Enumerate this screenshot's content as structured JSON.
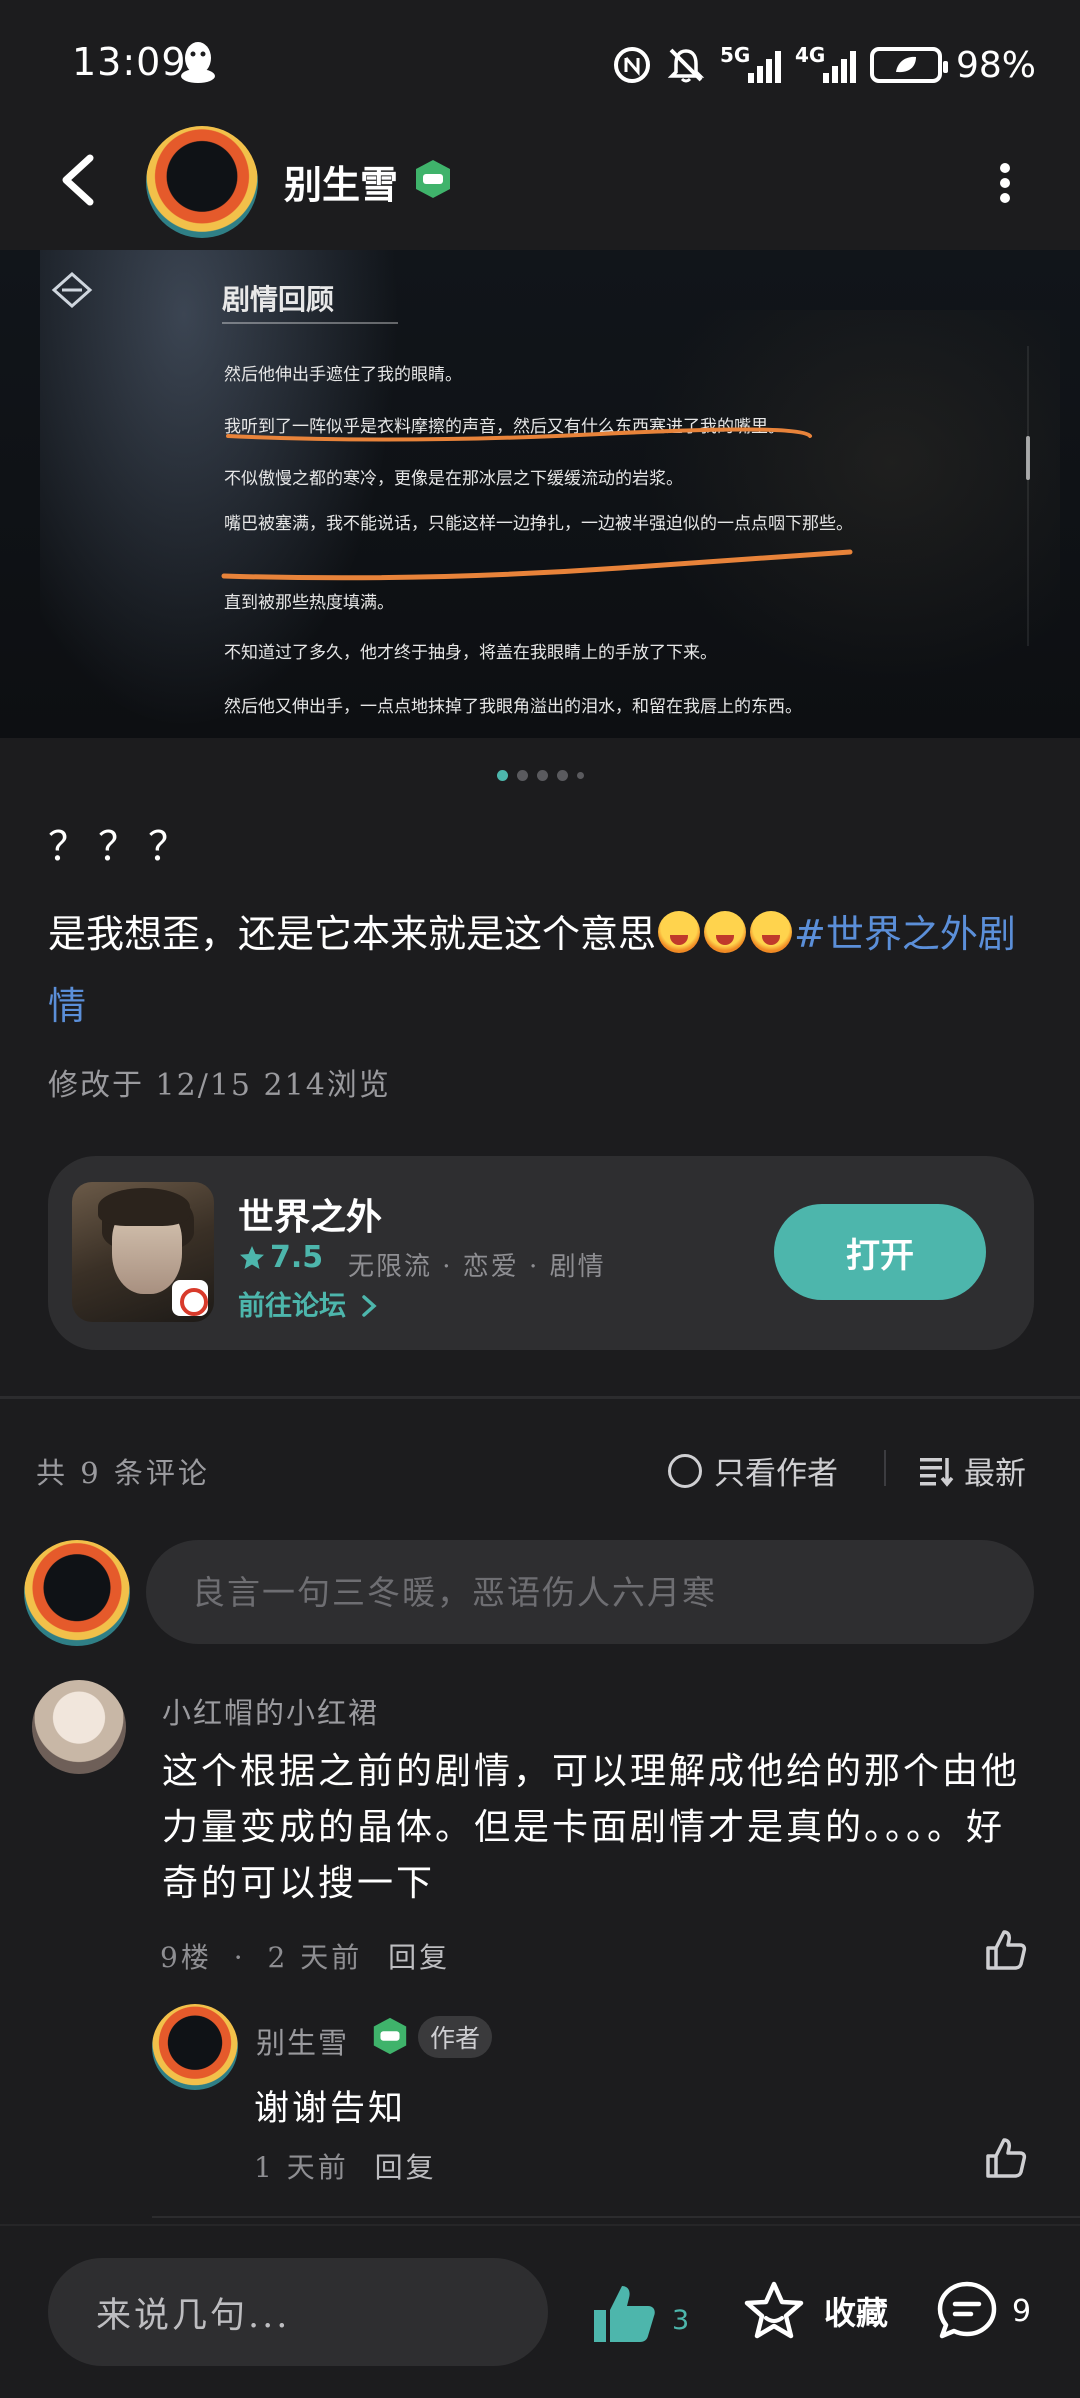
{
  "status_bar": {
    "time": "13:09",
    "battery": "98%",
    "net_5g": "5G",
    "net_4g": "4G"
  },
  "header": {
    "username": "别生雪"
  },
  "banner": {
    "title": "剧情回顾",
    "lines": [
      "然后他伸出手遮住了我的眼睛。",
      "我听到了一阵似乎是衣料摩擦的声音，然后又有什么东西塞进了我的嘴里。",
      "不似傲慢之都的寒冷，更像是在那冰层之下缓缓流动的岩浆。",
      "嘴巴被塞满，我不能说话，只能这样一边挣扎，一边被半强迫似的一点点咽下那些。",
      "直到被那些热度填满。",
      "不知道过了多久，他才终于抽身，将盖在我眼睛上的手放了下来。",
      "然后他又伸出手，一点点地抹掉了我眼角溢出的泪水，和留在我唇上的东西。"
    ],
    "page_count": 5,
    "active_page": 1
  },
  "post": {
    "title": "？？？",
    "body": "是我想歪，还是它本来就是这个意思",
    "tag": "#世界之外剧情",
    "meta": "修改于 12/15  214浏览"
  },
  "app_card": {
    "name": "世界之外",
    "rating": "7.5",
    "tags": "无限流 · 恋爱 · 剧情",
    "forum_link": "前往论坛",
    "open_label": "打开"
  },
  "comments_header": {
    "count_text": "共 9 条评论",
    "author_only": "只看作者",
    "sort": "最新"
  },
  "comment_input": {
    "placeholder": "良言一句三冬暖，恶语伤人六月寒"
  },
  "comment1": {
    "name": "小红帽的小红裙",
    "text": "这个根据之前的剧情，可以理解成他给的那个由他力量变成的晶体。但是卡面剧情才是真的。。。。好奇的可以搜一下",
    "floor": "9楼",
    "time": "2 天前",
    "reply": "回复"
  },
  "reply1": {
    "name": "别生雪",
    "badge": "作者",
    "text": "谢谢告知",
    "time": "1 天前",
    "reply": "回复"
  },
  "bottom_bar": {
    "input_placeholder": "来说几句...",
    "like_count": "3",
    "favorite_label": "收藏",
    "comment_count": "9"
  },
  "colors": {
    "accent": "#4db6ac",
    "tag": "#5b8fd9",
    "background": "#1c1c1e",
    "card": "#2e2e30",
    "underline": "#e8833a"
  },
  "icons": [
    "qq-icon",
    "nfc-icon",
    "mute-icon",
    "back-icon",
    "more-icon",
    "level-badge-icon",
    "star-icon",
    "chevron-right-icon",
    "sort-icon",
    "like-icon",
    "favorite-icon",
    "comment-icon"
  ]
}
